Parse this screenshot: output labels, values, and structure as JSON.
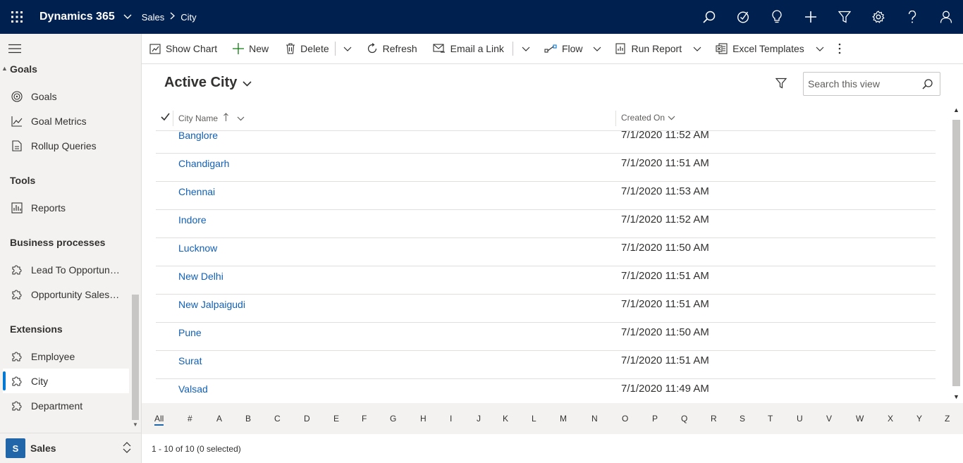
{
  "app": {
    "name": "Dynamics 365"
  },
  "breadcrumb": {
    "area": "Sales",
    "entity": "City"
  },
  "top_icons": [
    "search-icon",
    "assistant-icon",
    "lightbulb-icon",
    "plus-icon",
    "filter-icon",
    "gear-icon",
    "help-icon",
    "user-icon"
  ],
  "sidebar": {
    "groups": [
      {
        "title": "Goals",
        "items": [
          {
            "label": "Goals",
            "icon": "target-icon"
          },
          {
            "label": "Goal Metrics",
            "icon": "line-chart-icon"
          },
          {
            "label": "Rollup Queries",
            "icon": "document-icon"
          }
        ]
      },
      {
        "title": "Tools",
        "items": [
          {
            "label": "Reports",
            "icon": "report-icon"
          }
        ]
      },
      {
        "title": "Business processes",
        "items": [
          {
            "label": "Lead To Opportunity Sales Process",
            "icon": "puzzle-icon"
          },
          {
            "label": "Opportunity Sales Process",
            "icon": "puzzle-icon"
          }
        ]
      },
      {
        "title": "Extensions",
        "items": [
          {
            "label": "Employee",
            "icon": "puzzle-icon"
          },
          {
            "label": "City",
            "icon": "puzzle-icon",
            "selected": true
          },
          {
            "label": "Department",
            "icon": "puzzle-icon"
          }
        ]
      }
    ],
    "area_switcher": {
      "badge": "S",
      "label": "Sales"
    }
  },
  "commands": [
    {
      "label": "Show Chart",
      "icon": "chart-icon"
    },
    {
      "label": "New",
      "icon": "plus-icon"
    },
    {
      "label": "Delete",
      "icon": "trash-icon"
    },
    {
      "label": "Refresh",
      "icon": "refresh-icon"
    },
    {
      "label": "Email a Link",
      "icon": "email-link-icon"
    },
    {
      "label": "Flow",
      "icon": "flow-icon"
    },
    {
      "label": "Run Report",
      "icon": "report-icon"
    },
    {
      "label": "Excel Templates",
      "icon": "excel-icon"
    }
  ],
  "view": {
    "title": "Active City",
    "search_placeholder": "Search this view"
  },
  "grid": {
    "columns": [
      "City Name",
      "Created On"
    ],
    "rows": [
      {
        "city": "Banglore",
        "created": "7/1/2020 11:52 AM"
      },
      {
        "city": "Chandigarh",
        "created": "7/1/2020 11:51 AM"
      },
      {
        "city": "Chennai",
        "created": "7/1/2020 11:53 AM"
      },
      {
        "city": "Indore",
        "created": "7/1/2020 11:52 AM"
      },
      {
        "city": "Lucknow",
        "created": "7/1/2020 11:50 AM"
      },
      {
        "city": "New Delhi",
        "created": "7/1/2020 11:51 AM"
      },
      {
        "city": "New Jalpaigudi",
        "created": "7/1/2020 11:51 AM"
      },
      {
        "city": "Pune",
        "created": "7/1/2020 11:50 AM"
      },
      {
        "city": "Surat",
        "created": "7/1/2020 11:51 AM"
      },
      {
        "city": "Valsad",
        "created": "7/1/2020 11:49 AM"
      }
    ]
  },
  "jumpbar": [
    "All",
    "#",
    "A",
    "B",
    "C",
    "D",
    "E",
    "F",
    "G",
    "H",
    "I",
    "J",
    "K",
    "L",
    "M",
    "N",
    "O",
    "P",
    "Q",
    "R",
    "S",
    "T",
    "U",
    "V",
    "W",
    "X",
    "Y",
    "Z"
  ],
  "footer": {
    "status": "1 - 10 of 10 (0 selected)"
  },
  "colors": {
    "nav_bg": "#002050",
    "link": "#1160b7",
    "accent": "#0078d4",
    "sidebar_bg": "#f3f2f1"
  }
}
